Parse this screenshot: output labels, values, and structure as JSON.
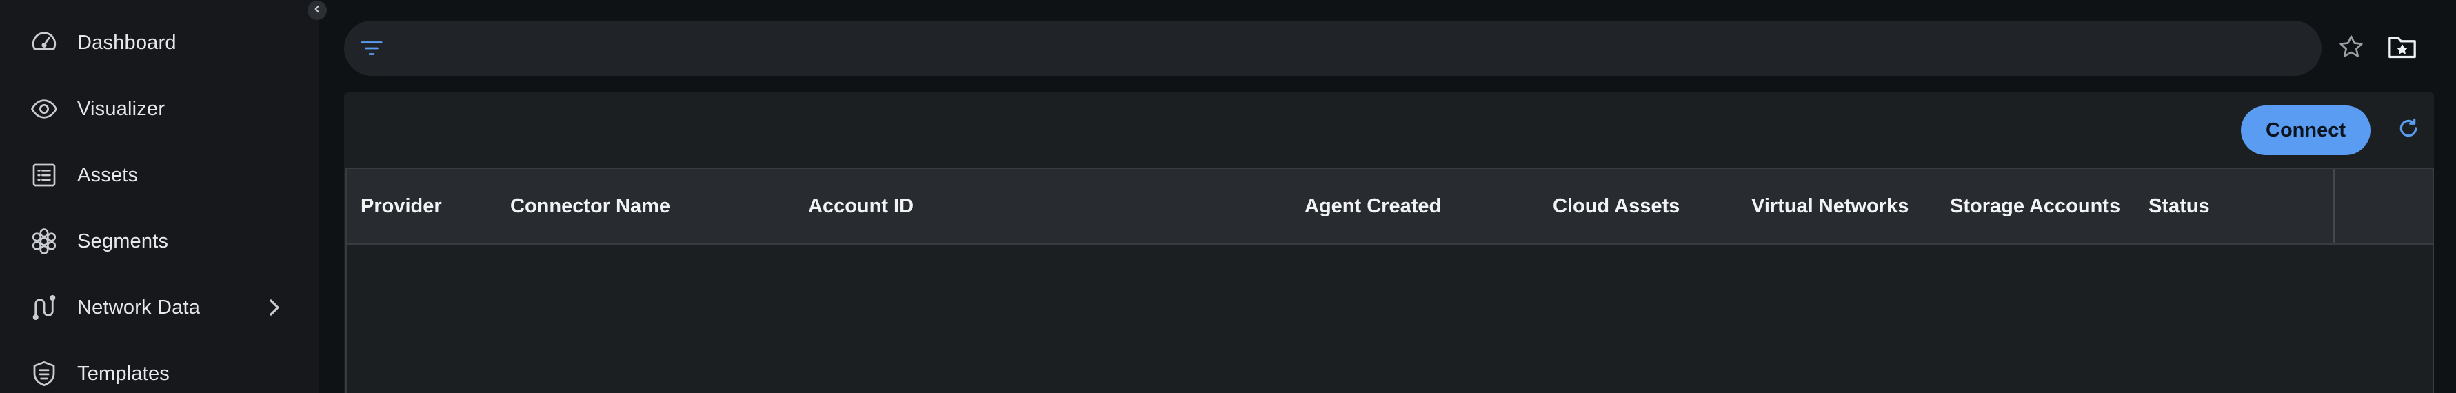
{
  "sidebar": {
    "items": [
      {
        "label": "Dashboard",
        "icon": "gauge-icon"
      },
      {
        "label": "Visualizer",
        "icon": "eye-icon"
      },
      {
        "label": "Assets",
        "icon": "list-icon"
      },
      {
        "label": "Segments",
        "icon": "segments-icon"
      },
      {
        "label": "Network Data",
        "icon": "network-data-icon",
        "expandable": true
      },
      {
        "label": "Templates",
        "icon": "shield-icon"
      }
    ]
  },
  "toolbar": {
    "filter_value": "",
    "favorite_icon": "star-icon",
    "folder_icon": "folder-star-icon"
  },
  "actions": {
    "connect_label": "Connect",
    "refresh_icon": "refresh-icon"
  },
  "table": {
    "columns": [
      "Provider",
      "Connector Name",
      "Account ID",
      "Agent Created",
      "Cloud Assets",
      "Virtual Networks",
      "Storage Accounts",
      "Status"
    ],
    "rows": []
  },
  "colors": {
    "accent": "#5a9cf2",
    "background": "#0f1215",
    "sidebar": "#16181b",
    "panel": "#1c1f22",
    "header": "#282b2f"
  }
}
